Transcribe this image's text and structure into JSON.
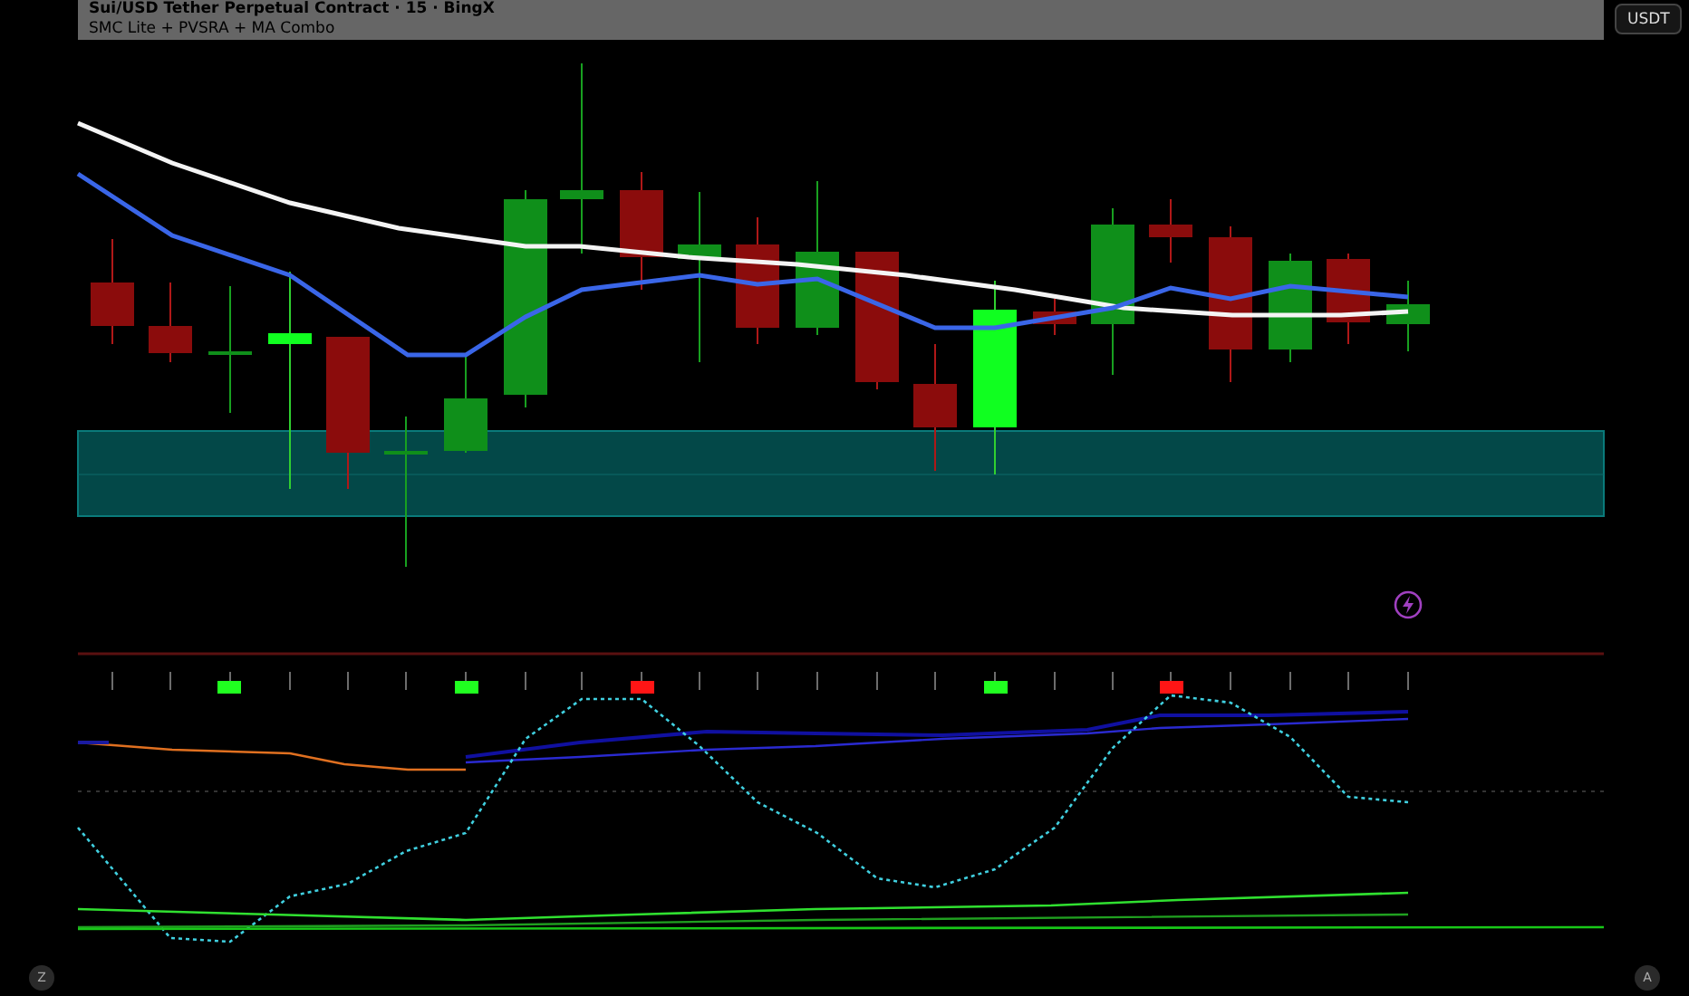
{
  "header": {
    "title": "Sui/USD Tether Perpetual Contract · 15 · BingX",
    "indicator": "SMC Lite + PVSRA + MA Combo"
  },
  "currency_button": "USDT",
  "bottom_buttons": [
    "Z",
    "A"
  ]
}
